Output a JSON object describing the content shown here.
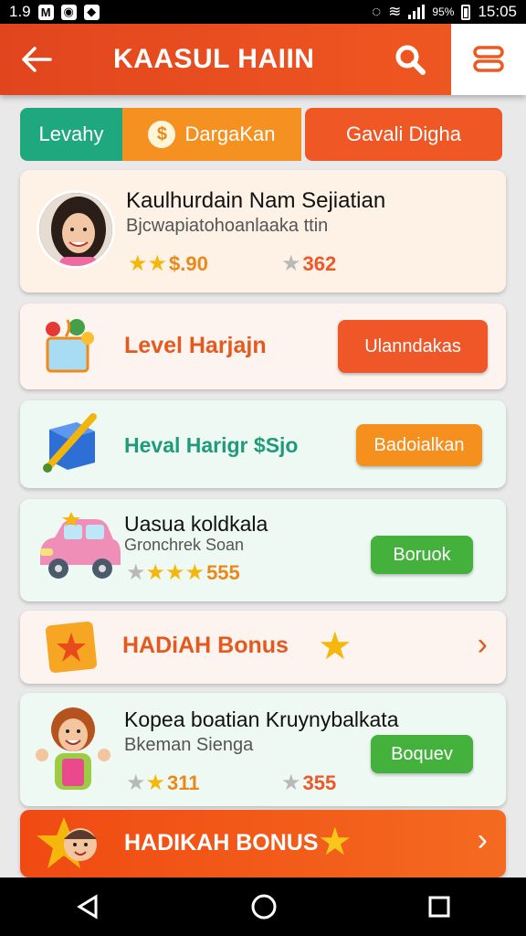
{
  "status_bar": {
    "left_text": "1.9",
    "time": "15:05",
    "battery": "95%"
  },
  "app_bar": {
    "title": "KAASUL HAIIN",
    "back_icon": "arrow-left-icon",
    "search_icon": "search-icon",
    "menu_icon": "menu-icon"
  },
  "tabs": [
    {
      "label": "Levahy"
    },
    {
      "label": "DargaKan"
    },
    {
      "label": "Gavali Digha"
    }
  ],
  "cards": {
    "profile": {
      "title": "Kaulhurdain Nam Sejiatian",
      "subtitle": "Bjcwapiatohoanlaaka ttin",
      "rating_left": "$.90",
      "rating_right": "362"
    },
    "level1": {
      "text": "Level Harjajn",
      "button": "Ulanndakas"
    },
    "level2": {
      "text": "Heval Harigr $Sjo",
      "button": "Badoialkan"
    },
    "car": {
      "title": "Uasua koldkala",
      "subtitle": "Gronchrek Soan",
      "rating": "555",
      "button": "Boruok"
    },
    "bonus1": {
      "text": "HADiAH Bonus"
    },
    "person": {
      "title": "Kopea boatian Kruynybalkata",
      "subtitle": "Bkeman Sienga",
      "rating_left": "311",
      "rating_right": "355",
      "button": "Boquev"
    },
    "bonus2": {
      "text": "HADIKAH BONUS"
    }
  },
  "colors": {
    "primary": "#f15a22",
    "green": "#1fa87d",
    "orange": "#f49120",
    "button_green": "#43b13c"
  }
}
